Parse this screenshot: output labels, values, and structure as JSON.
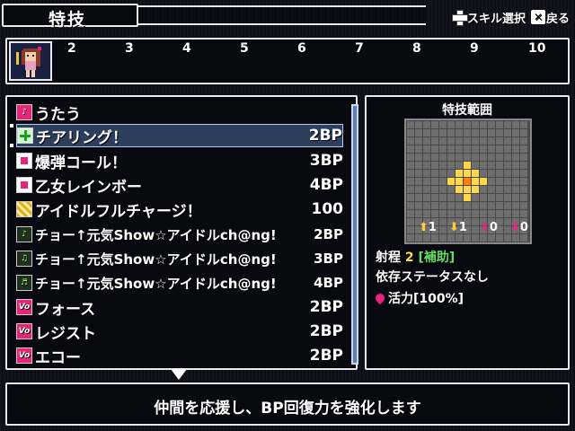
{
  "header": {
    "title": "特技",
    "skill_select_label": "スキル選択",
    "back_label": "戻る"
  },
  "party": {
    "slots": [
      "2",
      "3",
      "4",
      "5",
      "6",
      "7",
      "8",
      "9",
      "10"
    ]
  },
  "skills": [
    {
      "name": "うたう",
      "bp": "",
      "icon": "pink-note-icon"
    },
    {
      "name": "チアリング！",
      "bp": "2BP",
      "icon": "green-cross-icon"
    },
    {
      "name": "爆弾コール！",
      "bp": "3BP",
      "icon": "pink-square-icon"
    },
    {
      "name": "乙女レインボー",
      "bp": "4BP",
      "icon": "pink-square-icon"
    },
    {
      "name": "アイドルフルチャージ！",
      "bp": "100",
      "icon": "gold-icon"
    },
    {
      "name": "チョー↑元気Show☆アイドルch@ng!",
      "bp": "2BP",
      "icon": "music-note-icon"
    },
    {
      "name": "チョー↑元気Show☆アイドルch@ng!",
      "bp": "3BP",
      "icon": "music-note-2-icon"
    },
    {
      "name": "チョー↑元気Show☆アイドルch@ng!",
      "bp": "4BP",
      "icon": "music-note-3-icon"
    },
    {
      "name": "フォース",
      "bp": "2BP",
      "icon": "vo-icon"
    },
    {
      "name": "レジスト",
      "bp": "2BP",
      "icon": "vo-icon"
    },
    {
      "name": "エコー",
      "bp": "2BP",
      "icon": "vo-icon"
    }
  ],
  "selected_skill_index": 1,
  "range": {
    "title": "特技範囲",
    "stats": [
      "1",
      "1",
      "0",
      "0"
    ],
    "range_label": "射程",
    "range_value": "2",
    "range_type": "[補助]",
    "dependency": "依存ステータスなし",
    "vitality": "活力[100%]"
  },
  "description": "仲間を応援し、BP回復力を強化します",
  "colors": {
    "accent_pink": "#e8237a",
    "highlight_yellow": "#ffe040",
    "support_green": "#60e060",
    "selection_bg": "#2c3e5c"
  }
}
